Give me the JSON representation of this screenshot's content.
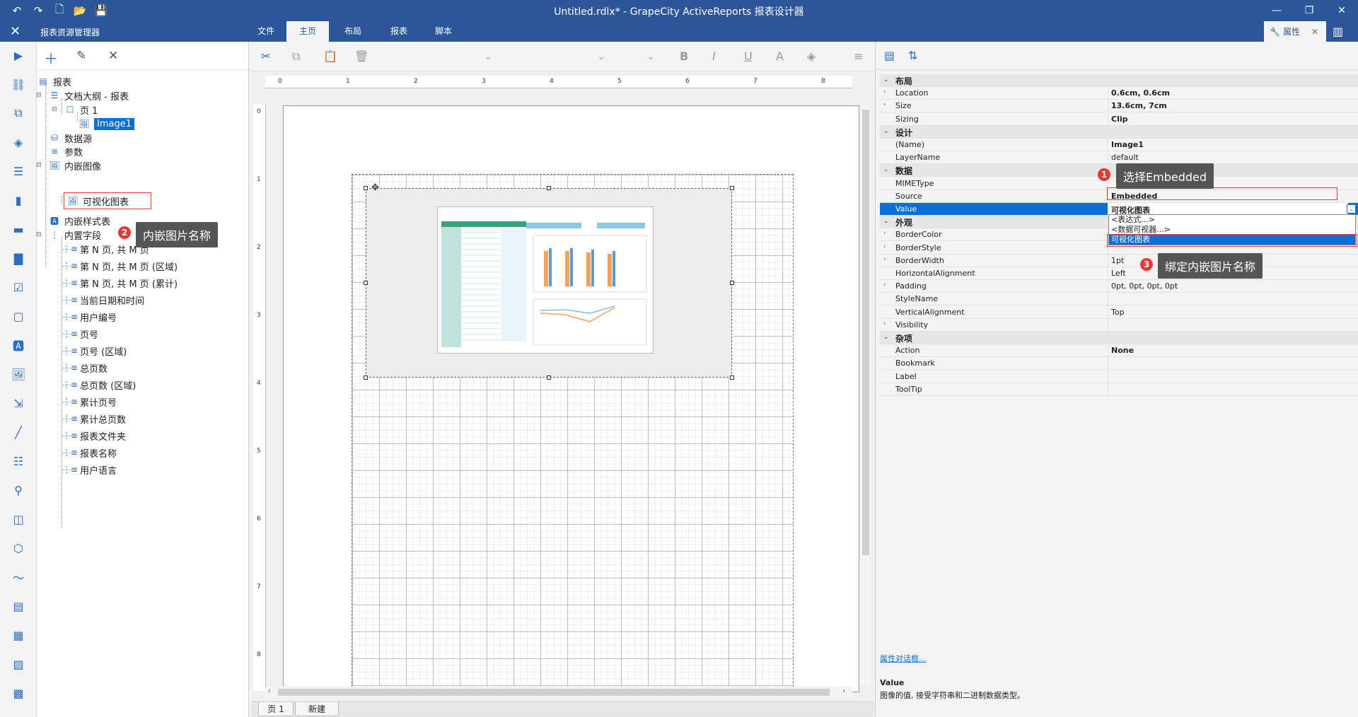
{
  "window": {
    "title": "Untitled.rdlx* - GrapeCity ActiveReports 报表设计器"
  },
  "ribbon": {
    "explorer_title": "报表资源管理器",
    "tabs": [
      {
        "label": "文件"
      },
      {
        "label": "主页"
      },
      {
        "label": "布局"
      },
      {
        "label": "报表"
      },
      {
        "label": "脚本"
      }
    ],
    "properties_tab": "属性"
  },
  "tree": {
    "root": "报表",
    "doc_outline": "文档大纲 - 报表",
    "page1": "页 1",
    "image1": "Image1",
    "datasource": "数据源",
    "params": "参数",
    "embedded_images": "内嵌图像",
    "embedded_image_item": "可视化图表",
    "embedded_styles": "内嵌样式表",
    "builtin_fields": "内置字段",
    "fields": [
      "第 N 页, 共 M 页",
      "第 N 页, 共 M 页 (区域)",
      "第 N 页, 共 M 页 (累计)",
      "当前日期和时间",
      "用户编号",
      "页号",
      "页号 (区域)",
      "总页数",
      "总页数 (区域)",
      "累计页号",
      "累计总页数",
      "报表文件夹",
      "报表名称",
      "用户语言"
    ]
  },
  "ruler": {
    "h_ticks": [
      "0",
      "1",
      "2",
      "3",
      "4",
      "5",
      "6",
      "7",
      "8"
    ],
    "v_ticks": [
      "0",
      "1",
      "2",
      "3",
      "4",
      "5",
      "6",
      "7",
      "8"
    ]
  },
  "page_tabs": [
    {
      "label": "页 1"
    },
    {
      "label": "新建"
    }
  ],
  "properties": {
    "rows": [
      {
        "type": "cat",
        "name": "布局"
      },
      {
        "name": "Location",
        "value": "0.6cm, 0.6cm",
        "bold": true,
        "exp": true
      },
      {
        "name": "Size",
        "value": "13.6cm, 7cm",
        "bold": true,
        "exp": true
      },
      {
        "name": "Sizing",
        "value": "Clip",
        "bold": true
      },
      {
        "type": "cat",
        "name": "设计"
      },
      {
        "name": "(Name)",
        "value": "Image1",
        "bold": true
      },
      {
        "name": "LayerName",
        "value": "default"
      },
      {
        "type": "cat",
        "name": "数据"
      },
      {
        "name": "MIMEType",
        "value": ""
      },
      {
        "name": "Source",
        "value": "Embedded",
        "bold": true
      },
      {
        "name": "Value",
        "value": "可视化图表",
        "selected": true
      },
      {
        "type": "cat",
        "name": "外观"
      },
      {
        "name": "BorderColor",
        "value": "",
        "exp": true
      },
      {
        "name": "BorderStyle",
        "value": "",
        "exp": true
      },
      {
        "name": "BorderWidth",
        "value": "1pt",
        "exp": true
      },
      {
        "name": "HorizontalAlignment",
        "value": "Left"
      },
      {
        "name": "Padding",
        "value": "0pt, 0pt, 0pt, 0pt",
        "exp": true
      },
      {
        "name": "StyleName",
        "value": ""
      },
      {
        "name": "VerticalAlignment",
        "value": "Top"
      },
      {
        "name": "Visibility",
        "value": "",
        "exp": true
      },
      {
        "type": "cat",
        "name": "杂项"
      },
      {
        "name": "Action",
        "value": "None",
        "bold": true
      },
      {
        "name": "Bookmark",
        "value": ""
      },
      {
        "name": "Label",
        "value": ""
      },
      {
        "name": "ToolTip",
        "value": ""
      }
    ],
    "dropdown_options": [
      "<表达式...>",
      "<数据可视器...>",
      "可视化图表"
    ],
    "dialog_link": "属性对话框...",
    "desc_title": "Value",
    "desc_text": "图像的值, 接受字符串和二进制数据类型。"
  },
  "callouts": {
    "c1": {
      "num": "1",
      "text": "选择Embedded"
    },
    "c2": {
      "num": "2",
      "text": "内嵌图片名称"
    },
    "c3": {
      "num": "3",
      "text": "绑定内嵌图片名称"
    }
  },
  "colors": {
    "accent": "#2b579a",
    "selection": "#0a6fd6",
    "callout_badge": "#e53935"
  }
}
